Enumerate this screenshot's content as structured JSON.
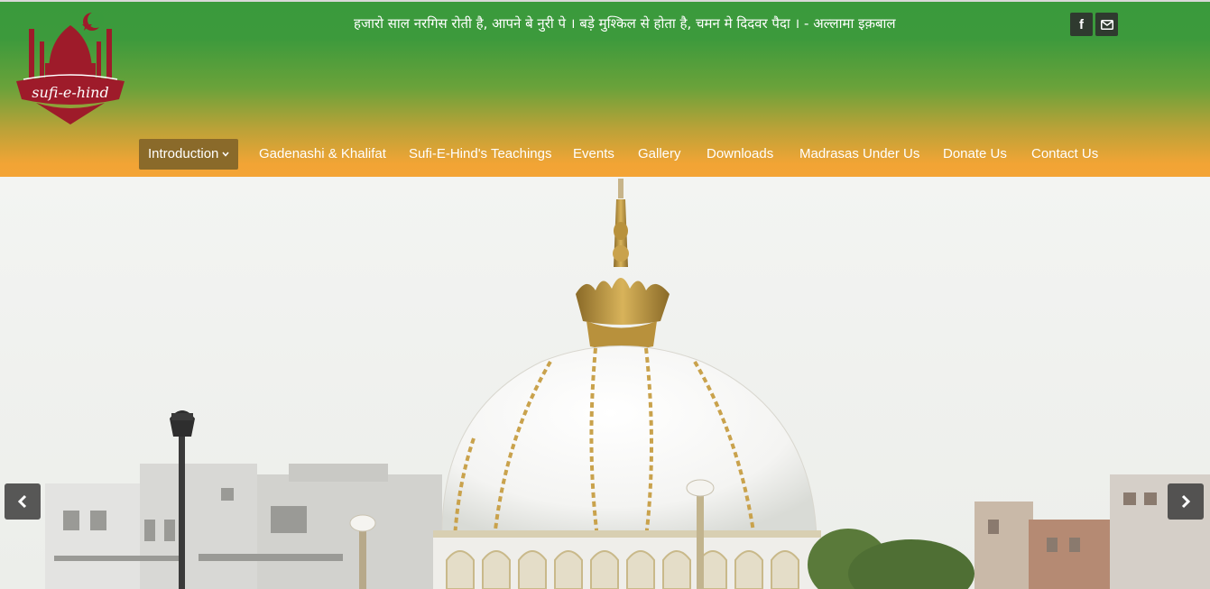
{
  "header": {
    "logo_text": "sufi-e-hind",
    "quote": "हजारो साल नरगिस रोती है, आपने बे नुरी पे । बड़े मुश्किल से होता है, चमन मे दिदवर पैदा । - अल्लामा इक़बाल",
    "social": [
      {
        "icon": "facebook-icon",
        "label": "f"
      },
      {
        "icon": "mail-icon"
      }
    ]
  },
  "nav": {
    "items": [
      {
        "label": "Introduction",
        "active": true
      },
      {
        "label": "Gadenashi & Khalifat"
      },
      {
        "label": "Sufi-E-Hind's Teachings"
      },
      {
        "label": "Events"
      },
      {
        "label": "Gallery"
      },
      {
        "label": "Downloads"
      },
      {
        "label": "Madrasas Under Us"
      },
      {
        "label": "Donate Us"
      },
      {
        "label": "Contact Us"
      }
    ]
  },
  "slider": {
    "prev_icon": "chevron-left-icon",
    "next_icon": "chevron-right-icon"
  },
  "colors": {
    "header_top": "#3a9a3c",
    "header_bottom": "#f4a436",
    "nav_active": "#8a6a2a",
    "logo_red": "#9e1b2a"
  }
}
